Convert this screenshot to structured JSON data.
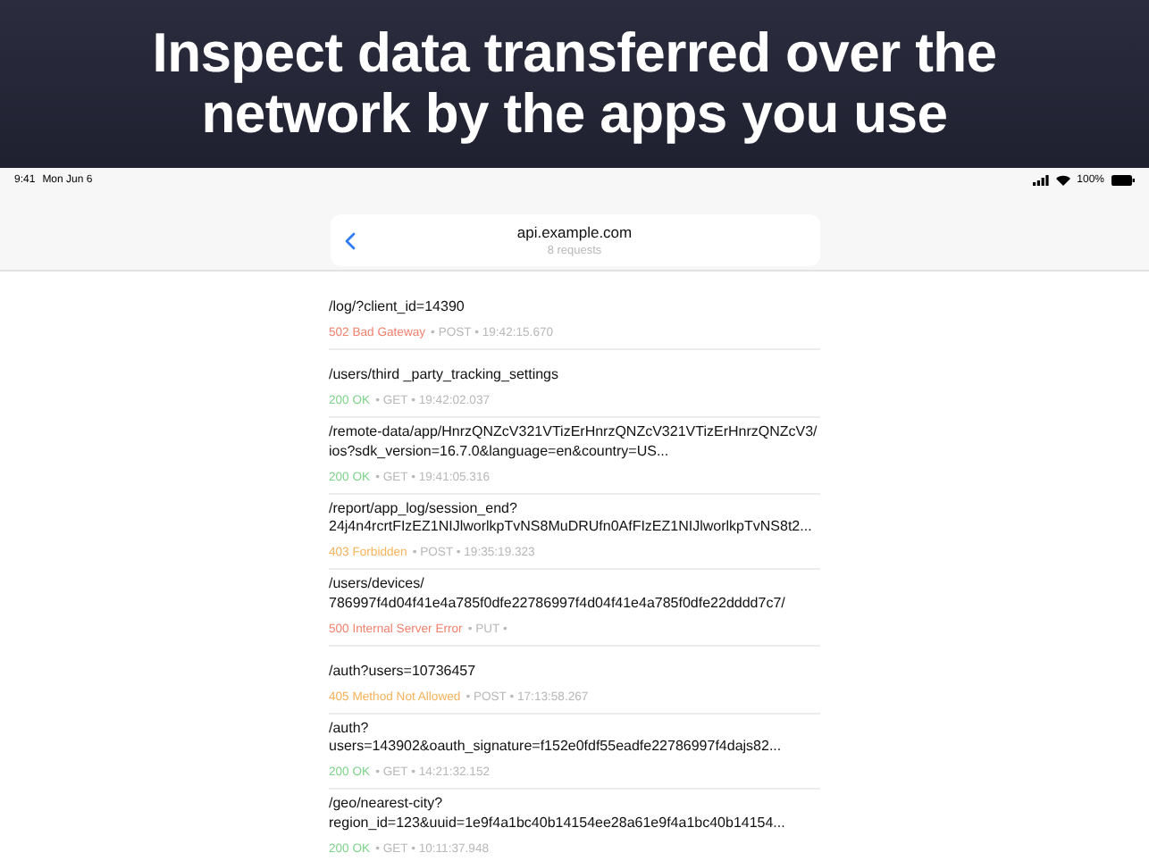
{
  "headline": "Inspect data transferred over the network by the apps you use",
  "status_bar": {
    "time": "9:41",
    "date": "Mon Jun 6",
    "battery": "100%"
  },
  "nav": {
    "title": "api.example.com",
    "subtitle": "8 requests"
  },
  "requests": [
    {
      "path_lines": [
        "/log/?client_id=14390"
      ],
      "status": "502 Bad Gateway",
      "color": "#f0826e",
      "meta": "• POST • 19:42:15.670"
    },
    {
      "path_lines": [
        "/users/third _party_tracking_settings"
      ],
      "status": "200 OK",
      "color": "#7fd38c",
      "meta": "• GET • 19:42:02.037"
    },
    {
      "path_lines": [
        "/remote-data/app/HnrzQNZcV321VTizErHnrzQNZcV321VTizErHnrzQNZcV3/",
        "ios?sdk_version=16.7.0&language=en&country=US..."
      ],
      "status": "200 OK",
      "color": "#7fd38c",
      "meta": "• GET • 19:41:05.316"
    },
    {
      "path_lines": [
        "/report/app_log/session_end?",
        "24j4n4rcrtFIzEZ1NIJlworlkpTvNS8MuDRUfn0AfFIzEZ1NIJlworlkpTvNS8t2..."
      ],
      "status": "403 Forbidden",
      "color": "#f5b25a",
      "meta": "• POST • 19:35:19.323"
    },
    {
      "path_lines": [
        "/users/devices/",
        "786997f4d04f41e4a785f0dfe22786997f4d04f41e4a785f0dfe22dddd7c7/"
      ],
      "status": "500 Internal Server Error",
      "color": "#f0826e",
      "meta": "• PUT •"
    },
    {
      "path_lines": [
        "/auth?users=10736457"
      ],
      "status": "405 Method Not Allowed",
      "color": "#f5b25a",
      "meta": "• POST • 17:13:58.267"
    },
    {
      "path_lines": [
        "/auth?",
        "users=143902&oauth_signature=f152e0fdf55eadfe22786997f4dajs82..."
      ],
      "status": "200 OK",
      "color": "#7fd38c",
      "meta": "• GET • 14:21:32.152"
    },
    {
      "path_lines": [
        "/geo/nearest-city?",
        "region_id=123&uuid=1e9f4a1bc40b14154ee28a61e9f4a1bc40b14154..."
      ],
      "status": "200 OK",
      "color": "#7fd38c",
      "meta": "• GET • 10:11:37.948"
    }
  ]
}
